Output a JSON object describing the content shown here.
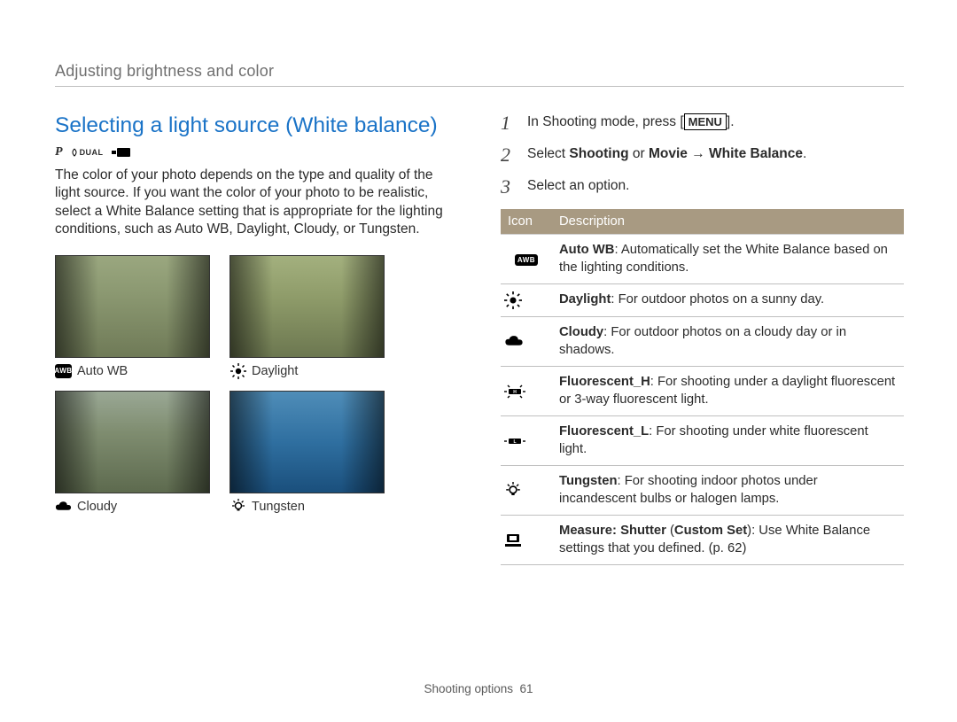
{
  "breadcrumb": "Adjusting brightness and color",
  "title": "Selecting a light source (White balance)",
  "modes": {
    "p": "P",
    "dual": "DUAL",
    "cam": ""
  },
  "intro": "The color of your photo depends on the type and quality of the light source. If you want the color of your photo to be realistic, select a White Balance setting that is appropriate for the lighting conditions, such as Auto WB, Daylight, Cloudy, or Tungsten.",
  "thumbs": {
    "autowb": "Auto WB",
    "daylight": "Daylight",
    "cloudy": "Cloudy",
    "tungsten": "Tungsten"
  },
  "steps": {
    "n1": "1",
    "s1_a": "In Shooting mode, press [",
    "s1_menu": "MENU",
    "s1_b": "].",
    "n2": "2",
    "s2_a": "Select ",
    "s2_b": "Shooting",
    "s2_c": " or ",
    "s2_d": "Movie",
    "s2_e": " → ",
    "s2_f": "White Balance",
    "s2_g": ".",
    "n3": "3",
    "s3": "Select an option."
  },
  "table": {
    "h_icon": "Icon",
    "h_desc": "Description",
    "rows": {
      "r1b": "Auto WB",
      "r1t": ": Automatically set the White Balance based on the lighting conditions.",
      "r2b": "Daylight",
      "r2t": ": For outdoor photos on a sunny day.",
      "r3b": "Cloudy",
      "r3t": ": For outdoor photos on a cloudy day or in shadows.",
      "r4b": "Fluorescent_H",
      "r4t": ": For shooting under a daylight fluorescent or 3-way fluorescent light.",
      "r5b": "Fluorescent_L",
      "r5t": ": For shooting under white fluorescent light.",
      "r6b": "Tungsten",
      "r6t": ": For shooting indoor photos under incandescent bulbs or halogen lamps.",
      "r7b": "Measure: Shutter",
      "r7b2": "Custom Set",
      "r7t": " (",
      "r7t2": "): Use White Balance settings that you defined. (p. 62)"
    }
  },
  "footer": {
    "label": "Shooting options",
    "page": "61"
  }
}
